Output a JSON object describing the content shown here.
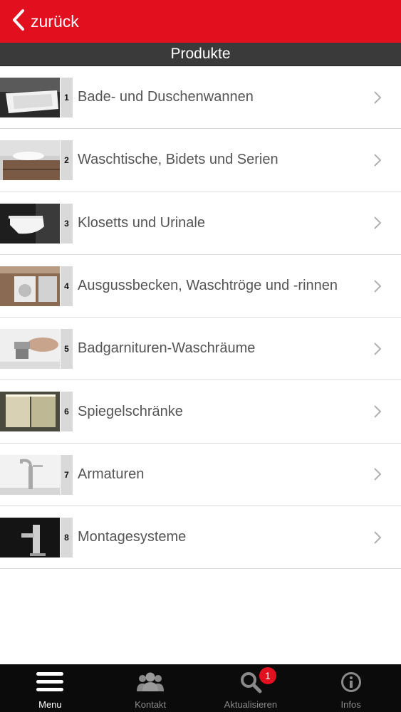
{
  "header": {
    "back_label": "zurück",
    "accent": "#e2101f"
  },
  "titlebar": {
    "title": "Produkte"
  },
  "products": [
    {
      "num": "1",
      "label": "Bade- und Duschenwannen"
    },
    {
      "num": "2",
      "label": "Waschtische, Bidets und Serien"
    },
    {
      "num": "3",
      "label": "Klosetts und Urinale"
    },
    {
      "num": "4",
      "label": "Ausgussbecken, Waschtröge und -rinnen"
    },
    {
      "num": "5",
      "label": "Badgarnituren-Waschräume"
    },
    {
      "num": "6",
      "label": "Spiegelschränke"
    },
    {
      "num": "7",
      "label": "Armaturen"
    },
    {
      "num": "8",
      "label": "Montagesysteme"
    }
  ],
  "tabbar": {
    "tabs": [
      {
        "label": "Menu",
        "icon": "menu-icon",
        "active": true
      },
      {
        "label": "Kontakt",
        "icon": "contacts-icon",
        "active": false
      },
      {
        "label": "Aktualisieren",
        "icon": "search-icon",
        "active": false,
        "badge": "1"
      },
      {
        "label": "Infos",
        "icon": "info-icon",
        "active": false
      }
    ]
  }
}
